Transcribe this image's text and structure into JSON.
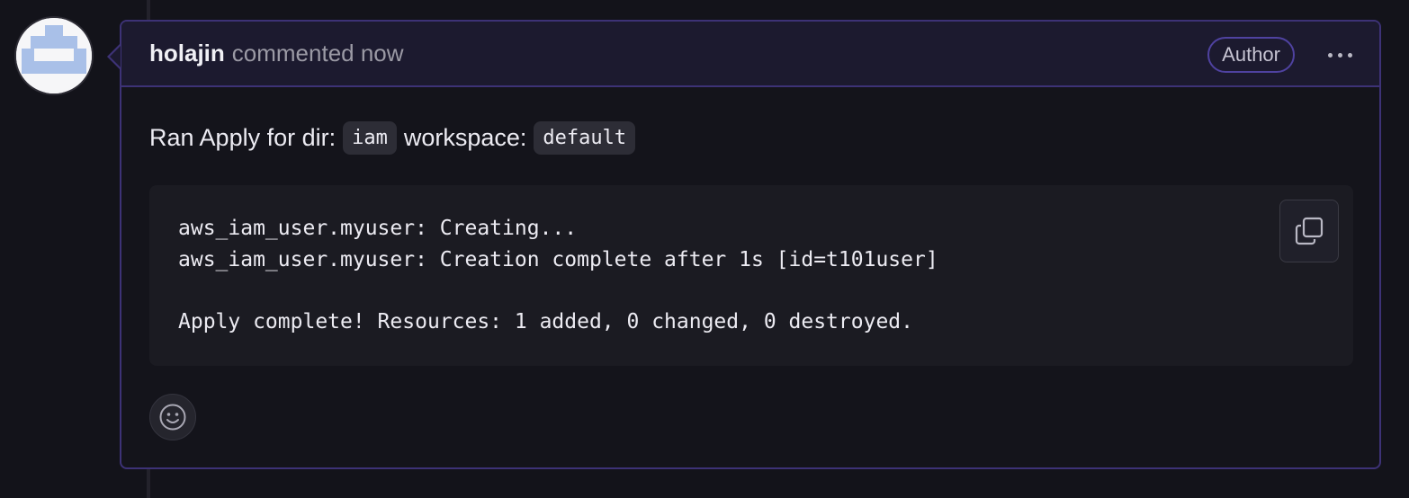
{
  "comment": {
    "author": "holajin",
    "meta": "commented now",
    "badge": "Author",
    "body": {
      "prefix": "Ran Apply for dir:",
      "dir": "iam",
      "workspace_label": "workspace:",
      "workspace": "default"
    },
    "code_lines": [
      "aws_iam_user.myuser: Creating...",
      "aws_iam_user.myuser: Creation complete after 1s [id=t101user]",
      "",
      "Apply complete! Resources: 1 added, 0 changed, 0 destroyed."
    ]
  },
  "icons": {
    "avatar": "identicon-avatar",
    "more": "kebab-horizontal-icon",
    "copy": "copy-icon",
    "reaction": "smiley-icon"
  },
  "colors": {
    "border_accent": "#3d3276",
    "header_bg": "#1c1a2f",
    "badge_border": "#4f42a0",
    "avatar_pattern": "#a9c0e8"
  }
}
